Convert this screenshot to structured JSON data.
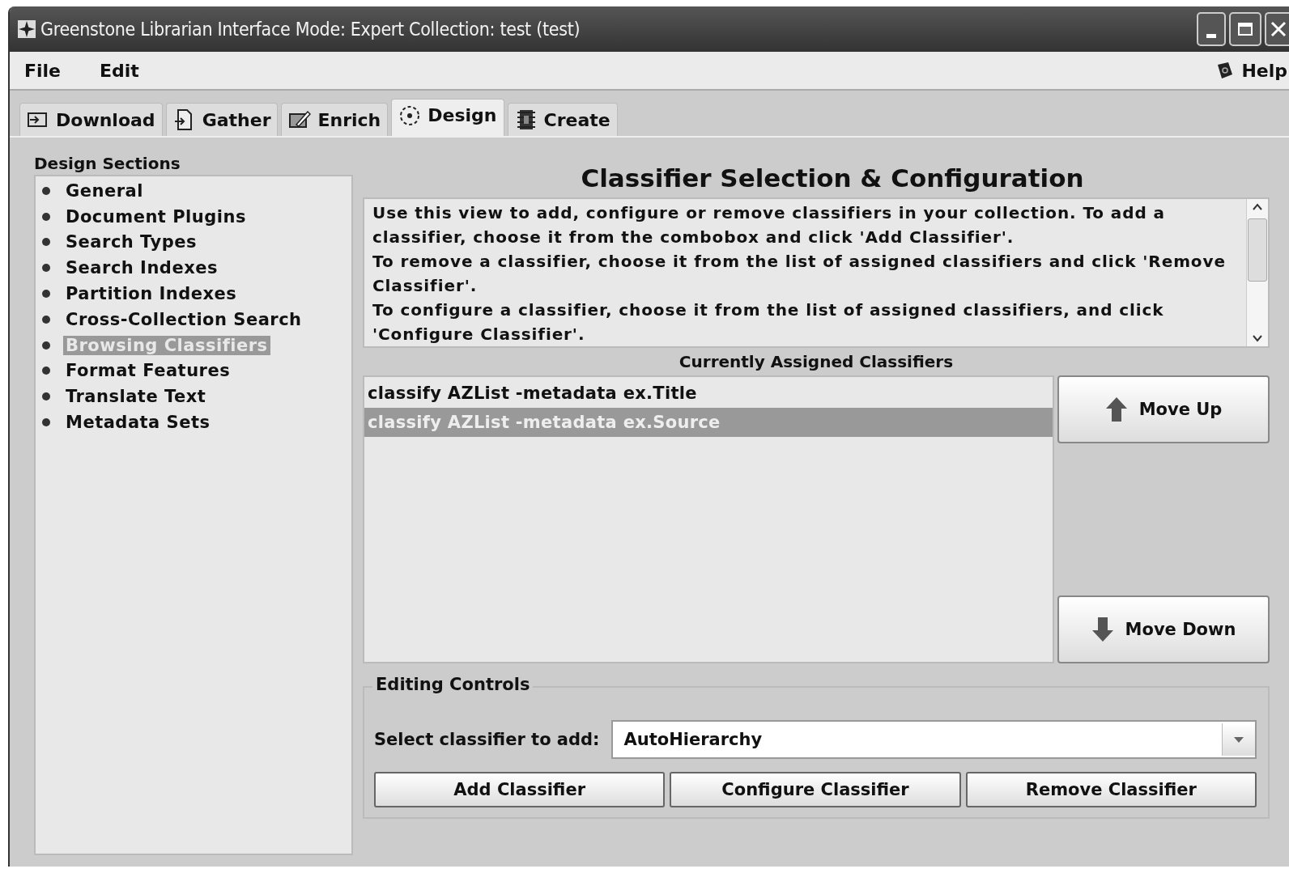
{
  "window": {
    "title": "Greenstone Librarian Interface  Mode: Expert  Collection: test (test)"
  },
  "menu": [
    {
      "label": "File"
    },
    {
      "label": "Edit"
    }
  ],
  "help": {
    "label": "Help"
  },
  "tabs": [
    {
      "label": "Download",
      "kind": "download",
      "selected": false
    },
    {
      "label": "Gather",
      "kind": "gather",
      "selected": false
    },
    {
      "label": "Enrich",
      "kind": "enrich",
      "selected": false
    },
    {
      "label": "Design",
      "kind": "design",
      "selected": true
    },
    {
      "label": "Create",
      "kind": "create",
      "selected": false
    }
  ],
  "sidebar": {
    "title": "Design Sections",
    "items": [
      {
        "label": "General",
        "selected": false
      },
      {
        "label": "Document Plugins",
        "selected": false
      },
      {
        "label": "Search Types",
        "selected": false
      },
      {
        "label": "Search Indexes",
        "selected": false
      },
      {
        "label": "Partition Indexes",
        "selected": false
      },
      {
        "label": "Cross-Collection Search",
        "selected": false
      },
      {
        "label": "Browsing Classifiers",
        "selected": true
      },
      {
        "label": "Format Features",
        "selected": false
      },
      {
        "label": "Translate Text",
        "selected": false
      },
      {
        "label": "Metadata Sets",
        "selected": false
      }
    ]
  },
  "main": {
    "title": "Classifier Selection & Configuration",
    "description": [
      "Use this view to add, configure or remove classifiers in your collection. To add a classifier, choose it from the combobox and click 'Add Classifier'.",
      "To remove a classifier, choose it from the list of assigned classifiers and click 'Remove Classifier'.",
      "To configure a classifier, choose it from the list of assigned classifiers, and click 'Configure Classifier'."
    ],
    "list_title": "Currently Assigned Classifiers",
    "classifiers": [
      {
        "label": "classify AZList -metadata ex.Title",
        "selected": false
      },
      {
        "label": "classify AZList -metadata ex.Source",
        "selected": true
      }
    ],
    "move_up": "Move Up",
    "move_down": "Move Down",
    "editing": {
      "title": "Editing Controls",
      "select_label": "Select classifier to add:",
      "select_value": "AutoHierarchy",
      "buttons": [
        "Add Classifier",
        "Configure Classifier",
        "Remove Classifier"
      ]
    }
  }
}
